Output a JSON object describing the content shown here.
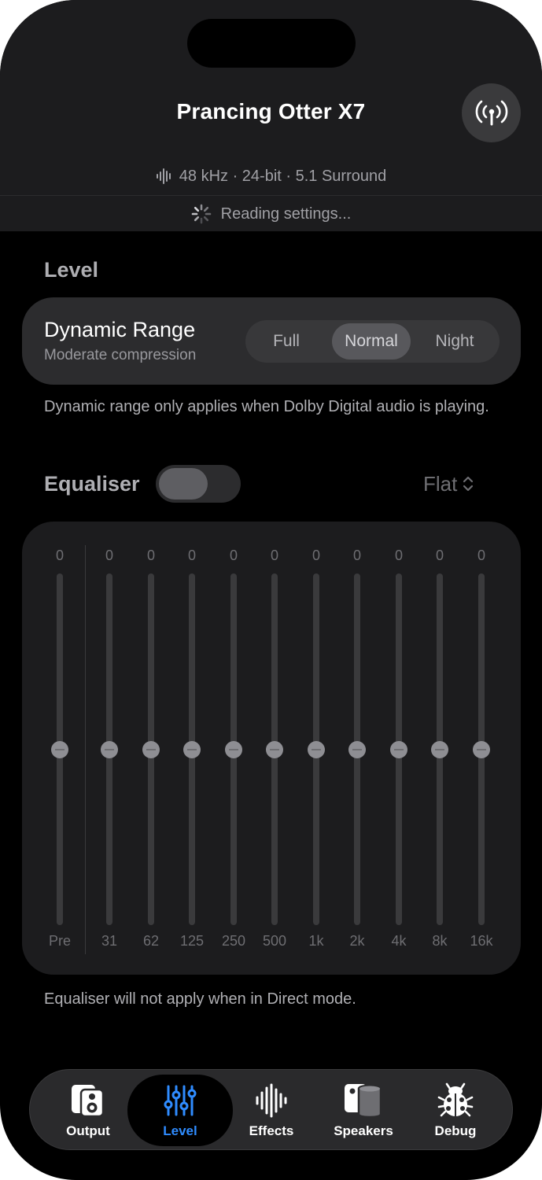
{
  "header": {
    "device_name": "Prancing Otter X7",
    "format": "48 kHz · 24-bit · 5.1 Surround",
    "status": "Reading settings..."
  },
  "level": {
    "section_title": "Level",
    "dynamic_range": {
      "title": "Dynamic Range",
      "subtitle": "Moderate compression",
      "options": [
        "Full",
        "Normal",
        "Night"
      ],
      "selected": "Normal"
    },
    "dynamic_range_note": "Dynamic range only applies when Dolby Digital audio is playing."
  },
  "equaliser": {
    "title": "Equaliser",
    "enabled": false,
    "preset": "Flat",
    "bands": [
      {
        "label": "Pre",
        "value": "0"
      },
      {
        "label": "31",
        "value": "0"
      },
      {
        "label": "62",
        "value": "0"
      },
      {
        "label": "125",
        "value": "0"
      },
      {
        "label": "250",
        "value": "0"
      },
      {
        "label": "500",
        "value": "0"
      },
      {
        "label": "1k",
        "value": "0"
      },
      {
        "label": "2k",
        "value": "0"
      },
      {
        "label": "4k",
        "value": "0"
      },
      {
        "label": "8k",
        "value": "0"
      },
      {
        "label": "16k",
        "value": "0"
      }
    ],
    "note": "Equaliser will not apply when in Direct mode."
  },
  "tabbar": {
    "tabs": [
      {
        "label": "Output",
        "icon": "speaker-box-icon"
      },
      {
        "label": "Level",
        "icon": "sliders-icon"
      },
      {
        "label": "Effects",
        "icon": "waveform-icon"
      },
      {
        "label": "Speakers",
        "icon": "speakers-icon"
      },
      {
        "label": "Debug",
        "icon": "ladybug-icon"
      }
    ],
    "selected": "Level"
  },
  "colors": {
    "accent": "#2f8cff",
    "background": "#000000",
    "header": "#1c1c1e",
    "card": "#2c2c2e"
  }
}
